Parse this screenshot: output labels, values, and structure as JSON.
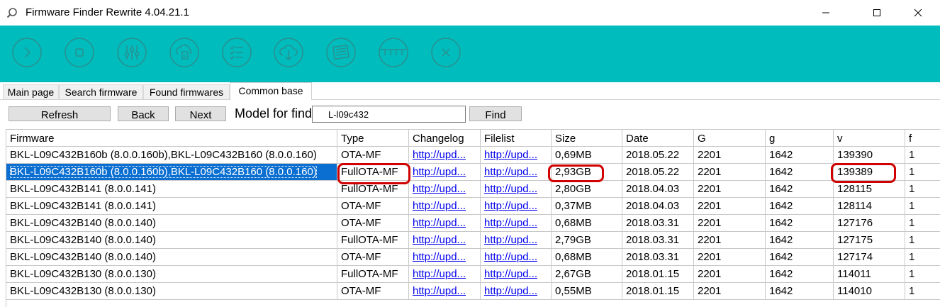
{
  "window": {
    "title": "Firmware Finder Rewrite 4.04.21.1",
    "controls": [
      "minimize",
      "maximize",
      "close"
    ]
  },
  "toolbar": {
    "buttons": [
      {
        "icon": "play-icon"
      },
      {
        "icon": "stop-icon"
      },
      {
        "icon": "sliders-icon"
      },
      {
        "icon": "cloud-document-icon"
      },
      {
        "icon": "checklist-icon"
      },
      {
        "icon": "cloud-download-icon"
      },
      {
        "icon": "newspaper-icon"
      },
      {
        "icon": "ruler-icon"
      },
      {
        "icon": "close-circle-icon"
      }
    ]
  },
  "tabs": [
    {
      "label": "Main page",
      "active": false
    },
    {
      "label": "Search firmware",
      "active": false
    },
    {
      "label": "Found firmwares",
      "active": false
    },
    {
      "label": "Common base",
      "active": true
    }
  ],
  "search": {
    "refresh_label": "Refresh",
    "back_label": "Back",
    "next_label": "Next",
    "model_label": "Model for find :",
    "model_value": "L-l09c432",
    "find_label": "Find"
  },
  "grid": {
    "columns": [
      "Firmware",
      "Type",
      "Changelog",
      "Filelist",
      "Size",
      "Date",
      "G",
      "g",
      "v",
      "f"
    ],
    "rows": [
      {
        "firmware": "BKL-L09C432B160b (8.0.0.160b),BKL-L09C432B160 (8.0.0.160)",
        "type": "OTA-MF",
        "changelog": "http://upd...",
        "filelist": "http://upd...",
        "size": "0,69MB",
        "date": "2018.05.22",
        "G": "2201",
        "g": "1642",
        "v": "139390",
        "f": "1"
      },
      {
        "firmware": "BKL-L09C432B160b (8.0.0.160b),BKL-L09C432B160 (8.0.0.160)",
        "type": "FullOTA-MF",
        "changelog": "http://upd...",
        "filelist": "http://upd...",
        "size": "2,93GB",
        "date": "2018.05.22",
        "G": "2201",
        "g": "1642",
        "v": "139389",
        "f": "1"
      },
      {
        "firmware": "BKL-L09C432B141 (8.0.0.141)",
        "type": "FullOTA-MF",
        "changelog": "http://upd...",
        "filelist": "http://upd...",
        "size": "2,80GB",
        "date": "2018.04.03",
        "G": "2201",
        "g": "1642",
        "v": "128115",
        "f": "1"
      },
      {
        "firmware": "BKL-L09C432B141 (8.0.0.141)",
        "type": "OTA-MF",
        "changelog": "http://upd...",
        "filelist": "http://upd...",
        "size": "0,37MB",
        "date": "2018.04.03",
        "G": "2201",
        "g": "1642",
        "v": "128114",
        "f": "1"
      },
      {
        "firmware": "BKL-L09C432B140 (8.0.0.140)",
        "type": "OTA-MF",
        "changelog": "http://upd...",
        "filelist": "http://upd...",
        "size": "0,68MB",
        "date": "2018.03.31",
        "G": "2201",
        "g": "1642",
        "v": "127176",
        "f": "1"
      },
      {
        "firmware": "BKL-L09C432B140 (8.0.0.140)",
        "type": "FullOTA-MF",
        "changelog": "http://upd...",
        "filelist": "http://upd...",
        "size": "2,79GB",
        "date": "2018.03.31",
        "G": "2201",
        "g": "1642",
        "v": "127175",
        "f": "1"
      },
      {
        "firmware": "BKL-L09C432B140 (8.0.0.140)",
        "type": "OTA-MF",
        "changelog": "http://upd...",
        "filelist": "http://upd...",
        "size": "0,68MB",
        "date": "2018.03.31",
        "G": "2201",
        "g": "1642",
        "v": "127174",
        "f": "1"
      },
      {
        "firmware": "BKL-L09C432B130 (8.0.0.130)",
        "type": "FullOTA-MF",
        "changelog": "http://upd...",
        "filelist": "http://upd...",
        "size": "2,67GB",
        "date": "2018.01.15",
        "G": "2201",
        "g": "1642",
        "v": "114011",
        "f": "1"
      },
      {
        "firmware": "BKL-L09C432B130 (8.0.0.130)",
        "type": "OTA-MF",
        "changelog": "http://upd...",
        "filelist": "http://upd...",
        "size": "0,55MB",
        "date": "2018.01.15",
        "G": "2201",
        "g": "1642",
        "v": "114010",
        "f": "1"
      }
    ],
    "selected_row": 1
  },
  "colors": {
    "toolbar_bg": "#00bcbc",
    "selection_bg": "#0a6fd1",
    "link": "#0000ee",
    "annotation": "#d00000"
  }
}
